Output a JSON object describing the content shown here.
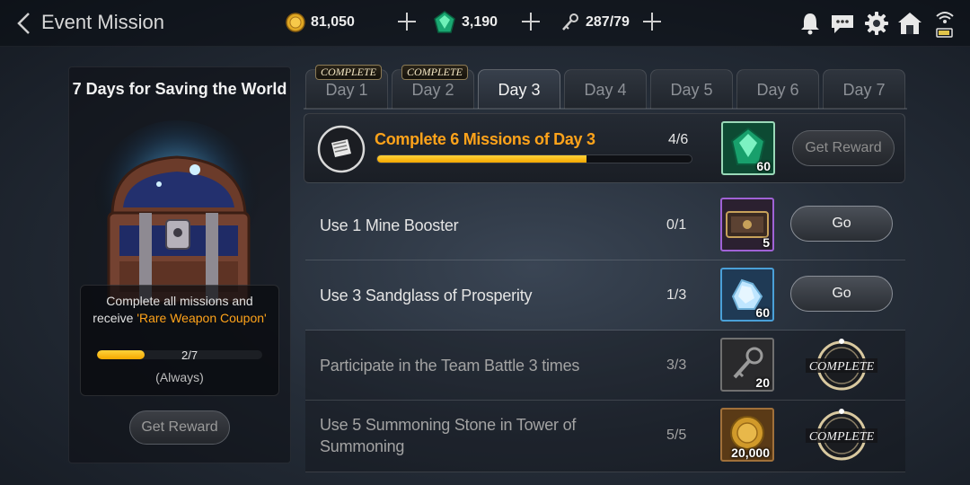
{
  "header": {
    "title": "Event Mission",
    "gold": "81,050",
    "gems": "3,190",
    "stamina": "287/79"
  },
  "side_panel": {
    "title": "7 Days for Saving the World",
    "desc_line1": "Complete all missions and",
    "desc_prefix": "receive ",
    "desc_highlight": "'Rare Weapon Coupon'",
    "progress_text": "2/7",
    "progress_value": 0.2857,
    "note": "(Always)",
    "reward_button": "Get Reward"
  },
  "tabs": [
    {
      "label": "Day 1",
      "tag": "COMPLETE"
    },
    {
      "label": "Day 2",
      "tag": "COMPLETE"
    },
    {
      "label": "Day 3",
      "tag": ""
    },
    {
      "label": "Day 4",
      "tag": ""
    },
    {
      "label": "Day 5",
      "tag": ""
    },
    {
      "label": "Day 6",
      "tag": ""
    },
    {
      "label": "Day 7",
      "tag": ""
    }
  ],
  "active_tab": 2,
  "main_mission": {
    "title": "Complete 6 Missions of Day 3",
    "count": "4/6",
    "progress_value": 0.6667,
    "reward_qty": "60",
    "reward_icon": "green-gem-icon",
    "button": "Get Reward"
  },
  "missions": [
    {
      "text": "Use 1 Mine Booster",
      "count": "0/1",
      "reward_qty": "5",
      "reward_icon": "nova-stone-ticket-icon",
      "button": "Go",
      "done": false
    },
    {
      "text": "Use 3 Sandglass of Prosperity",
      "count": "1/3",
      "reward_qty": "60",
      "reward_icon": "crystal-shard-icon",
      "button": "Go",
      "done": false
    },
    {
      "text": "Participate in the Team Battle 3 times",
      "count": "3/3",
      "reward_qty": "20",
      "reward_icon": "key-icon",
      "button": "COMPLETE",
      "done": true
    },
    {
      "text_line1": "Use 5 Summoning Stone in Tower of",
      "text_line2": "Summoning",
      "count": "5/5",
      "reward_qty": "20,000",
      "reward_icon": "gold-coin-icon",
      "button": "COMPLETE",
      "done": true
    }
  ],
  "colors": {
    "accent_orange": "#ffa31a",
    "progress_yellow": "#f5b800"
  }
}
